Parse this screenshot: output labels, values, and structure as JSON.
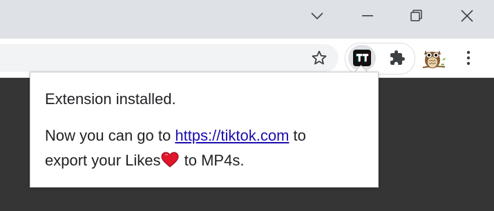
{
  "popup": {
    "title": "Extension installed.",
    "line_prefix": "Now you can go to ",
    "link_text": "https://tiktok.com",
    "line_middle": " to",
    "line2_prefix": "export your Likes",
    "line2_suffix": " to MP4s."
  },
  "extension": {
    "logo_text": "TT"
  },
  "colors": {
    "titlebar": "#dee1e6",
    "toolbar": "#ffffff",
    "page_background": "#353535",
    "link": "#1a0dab",
    "heart": "#e0162b"
  },
  "icons": {
    "tab_search": "chevron-down-icon",
    "minimize": "minimize-icon",
    "restore": "restore-icon",
    "close": "close-icon",
    "bookmark": "star-icon",
    "extension": "tiktok-extension-icon",
    "extensions_menu": "puzzle-icon",
    "profile": "owl-avatar-icon",
    "menu": "kebab-menu-icon"
  }
}
